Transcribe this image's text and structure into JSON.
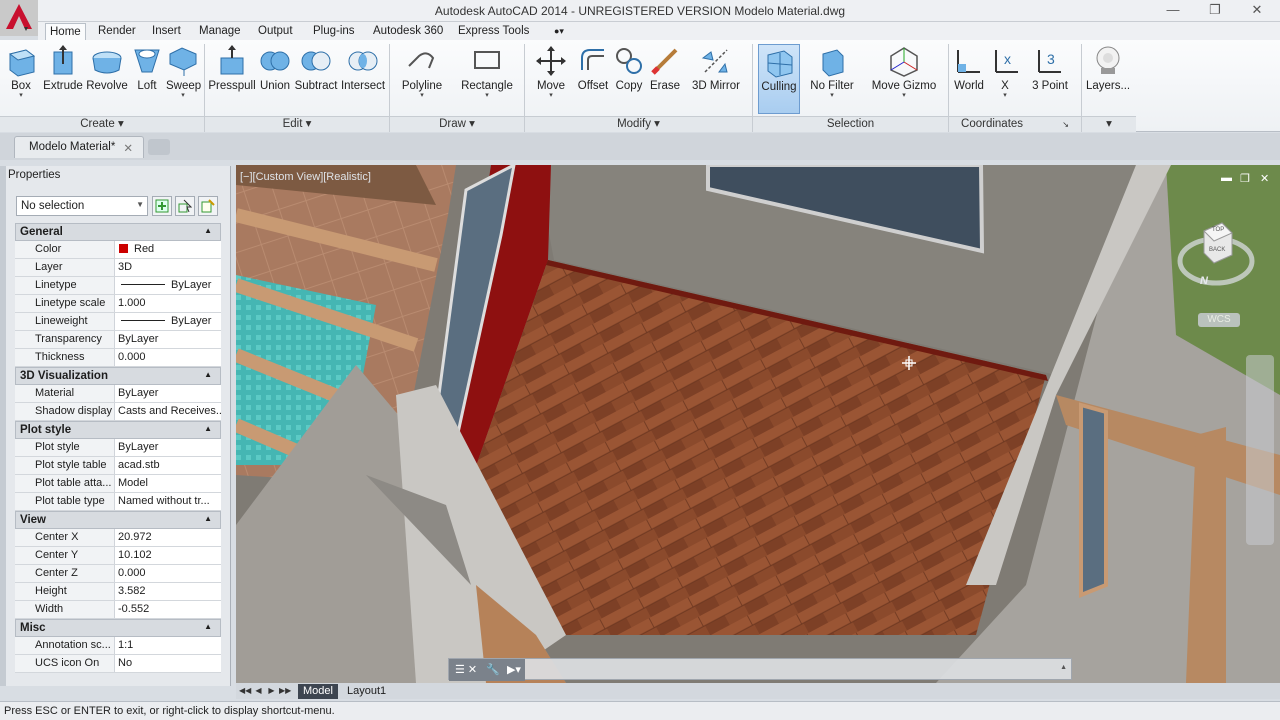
{
  "window": {
    "title": "Autodesk AutoCAD 2014 - UNREGISTERED VERSION    Modelo Material.dwg",
    "controls": [
      "minimize",
      "restore",
      "close"
    ]
  },
  "ribbon_tabs": [
    "Home",
    "Render",
    "Insert",
    "Manage",
    "Output",
    "Plug-ins",
    "Autodesk 360",
    "Express Tools"
  ],
  "ribbon": {
    "create": {
      "label": "Create",
      "buttons": [
        "Box",
        "Extrude",
        "Revolve",
        "Loft",
        "Sweep"
      ]
    },
    "edit": {
      "label": "Edit",
      "buttons": [
        "Presspull",
        "Union",
        "Subtract",
        "Intersect"
      ]
    },
    "draw": {
      "label": "Draw",
      "buttons": [
        "Polyline",
        "Rectangle"
      ]
    },
    "modify": {
      "label": "Modify",
      "buttons": [
        "Move",
        "Offset",
        "Copy",
        "Erase",
        "3D Mirror"
      ]
    },
    "selection": {
      "label": "Selection",
      "buttons": [
        "Culling",
        "No Filter",
        "Move Gizmo"
      ]
    },
    "coordinates": {
      "label": "Coordinates",
      "buttons": [
        "World",
        "X",
        "3 Point"
      ]
    },
    "layers": {
      "label": "Layers..."
    }
  },
  "doc_tab": {
    "name": "Modelo Material*"
  },
  "properties": {
    "title": "Properties",
    "selection": "No selection",
    "categories": [
      {
        "name": "General",
        "rows": [
          {
            "k": "Color",
            "v": "Red"
          },
          {
            "k": "Layer",
            "v": "3D"
          },
          {
            "k": "Linetype",
            "v": "ByLayer"
          },
          {
            "k": "Linetype scale",
            "v": "1.000"
          },
          {
            "k": "Lineweight",
            "v": "ByLayer"
          },
          {
            "k": "Transparency",
            "v": "ByLayer"
          },
          {
            "k": "Thickness",
            "v": "0.000"
          }
        ]
      },
      {
        "name": "3D Visualization",
        "rows": [
          {
            "k": "Material",
            "v": "ByLayer"
          },
          {
            "k": "Shadow display",
            "v": "Casts and Receives..."
          }
        ]
      },
      {
        "name": "Plot style",
        "rows": [
          {
            "k": "Plot style",
            "v": "ByLayer"
          },
          {
            "k": "Plot style table",
            "v": "acad.stb"
          },
          {
            "k": "Plot table atta...",
            "v": "Model"
          },
          {
            "k": "Plot table type",
            "v": "Named without tr..."
          }
        ]
      },
      {
        "name": "View",
        "rows": [
          {
            "k": "Center X",
            "v": "20.972"
          },
          {
            "k": "Center Y",
            "v": "10.102"
          },
          {
            "k": "Center Z",
            "v": "0.000"
          },
          {
            "k": "Height",
            "v": "3.582"
          },
          {
            "k": "Width",
            "v": "-0.552"
          }
        ]
      },
      {
        "name": "Misc",
        "rows": [
          {
            "k": "Annotation sc...",
            "v": "1:1"
          },
          {
            "k": "UCS icon On",
            "v": "No"
          }
        ]
      }
    ]
  },
  "viewport": {
    "label": "[−][Custom View][Realistic]",
    "viewcube": {
      "top": "TOP",
      "back": "BACK",
      "compass_n": "N",
      "wcs": "WCS"
    }
  },
  "layout_tabs": [
    "Model",
    "Layout1"
  ],
  "status": "Press ESC or ENTER to exit, or right-click to display shortcut-menu.",
  "colors": {
    "red_swatch": "#cc0000",
    "accent": "#cc0000"
  }
}
